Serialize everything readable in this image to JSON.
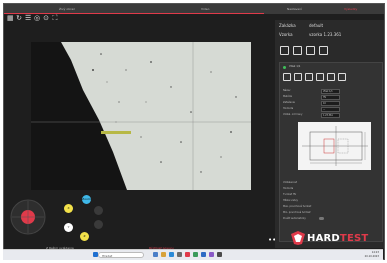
{
  "window": {
    "tabs": [
      "Živý obraz",
      "Video",
      "Nastavení",
      "Výsledky"
    ],
    "active_tab_index": 3
  },
  "toolbar": {
    "icons": [
      "grid-icon",
      "rotate-icon",
      "list-icon",
      "target-icon",
      "record-icon",
      "fullscreen-icon"
    ]
  },
  "right_panel": {
    "rows": [
      {
        "label": "Zakázka",
        "value": "default"
      },
      {
        "label": "Vzorka",
        "value": "vzorka 1.23.361"
      }
    ],
    "header_icons": [
      "new-file-icon",
      "save-icon",
      "save-as-icon",
      "settings-icon"
    ],
    "inner": {
      "title": "Vtisk 1/1",
      "icons": [
        "measure-icon",
        "settings-icon",
        "arrows-icon",
        "refresh-icon",
        "user-icon",
        "export-icon"
      ],
      "fields": [
        {
          "label": "Název",
          "value": "Vtisk 1/1"
        },
        {
          "label": "Metóda",
          "value": "HV"
        },
        {
          "label": "Zaťaženie",
          "value": "10"
        },
        {
          "label": "Hodnota",
          "value": "—"
        },
        {
          "label": "Vzdial. od hrany",
          "value": "1.23.361"
        }
      ],
      "results": [
        {
          "label": "Vzdialenosť",
          "value": ""
        },
        {
          "label": "Hodnota",
          "value": ""
        },
        {
          "label": "Tvrdosť HV",
          "value": ""
        },
        {
          "label": "Hĺbka vrstvy",
          "value": ""
        },
        {
          "label": "Max. povrchová tvrdosť",
          "value": ""
        },
        {
          "label": "Min. povrchová tvrdosť",
          "value": ""
        },
        {
          "label": "Použiť automaticky",
          "value": ""
        }
      ]
    }
  },
  "controls": {
    "buttons": [
      {
        "label": "Zoom",
        "color": "#3fb8e8"
      },
      {
        "label": "X",
        "color": "#f2e14a"
      },
      {
        "label": "Y",
        "color": "#ffffff"
      },
      {
        "label": "Z",
        "color": "#f2e14a"
      }
    ],
    "status_left": "Z Režim ovládania",
    "status_right": "Rýchlosť posuvu"
  },
  "more_label": "•••",
  "logo": {
    "text_a": "HARD",
    "text_b": "TEST"
  },
  "taskbar": {
    "search_placeholder": "Hľadať",
    "time": "14:23",
    "date": "20.10.2023"
  },
  "colors": {
    "accent": "#e03a4a",
    "panel": "#2a2a2a",
    "background": "#1e1e1e"
  }
}
